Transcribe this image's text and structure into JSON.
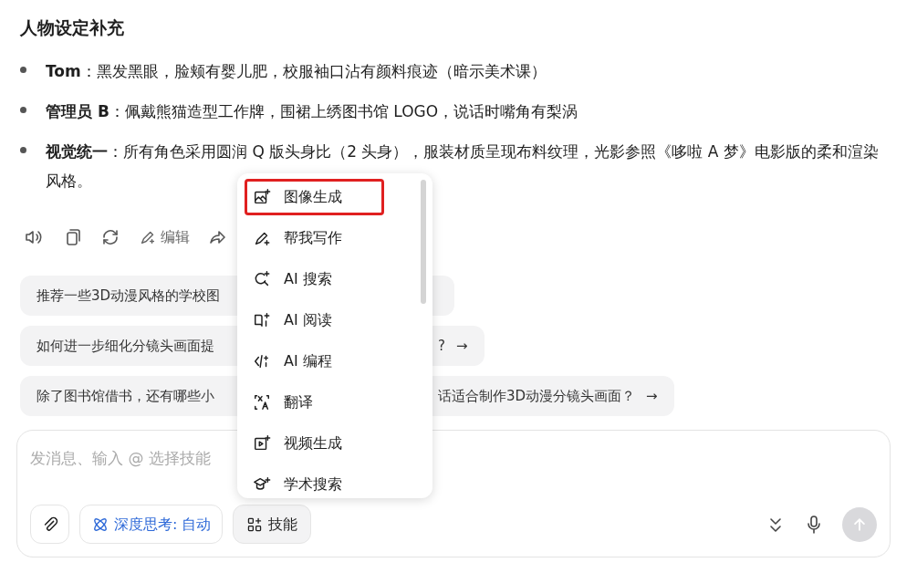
{
  "section_title": "人物设定补充",
  "bullets": [
    {
      "label": "Tom",
      "text": "：黑发黑眼，脸颊有婴儿肥，校服袖口沾有颜料痕迹（暗示美术课）"
    },
    {
      "label": "管理员 B",
      "text": "：佩戴熊猫造型工作牌，围裙上绣图书馆 LOGO，说话时嘴角有梨涡"
    },
    {
      "label": "视觉统一",
      "text": "：所有角色采用圆润 Q 版头身比（2 头身），服装材质呈现布料纹理，光影参照《哆啦 A 梦》电影版的柔和渲染风格。"
    }
  ],
  "actions": [
    {
      "kind": "speaker"
    },
    {
      "kind": "copy"
    },
    {
      "kind": "refresh"
    },
    {
      "kind": "edit",
      "label": "编辑"
    },
    {
      "kind": "share"
    }
  ],
  "suggestions": [
    {
      "text_before": "推荐一些3D动漫风格的学校图"
    },
    {
      "text_before": "如何进一步细化分镜头画面提",
      "text_after": "?",
      "arrow": "→"
    },
    {
      "text_before": "除了图书馆借书，还有哪些小",
      "text_after": "话适合制作3D动漫分镜头画面？",
      "arrow": "→"
    }
  ],
  "menu": {
    "items": [
      {
        "kind": "image",
        "label": "图像生成",
        "highlighted": true
      },
      {
        "kind": "write",
        "label": "帮我写作",
        "highlighted": false
      },
      {
        "kind": "search",
        "label": "AI 搜索",
        "highlighted": false
      },
      {
        "kind": "read",
        "label": "AI 阅读",
        "highlighted": false
      },
      {
        "kind": "code",
        "label": "AI 编程",
        "highlighted": false
      },
      {
        "kind": "translate",
        "label": "翻译",
        "highlighted": false
      },
      {
        "kind": "video",
        "label": "视频生成",
        "highlighted": false
      },
      {
        "kind": "academic",
        "label": "学术搜索",
        "highlighted": false
      }
    ]
  },
  "composer": {
    "placeholder": "发消息、输入 @ 选择技能",
    "deep_think": "深度思考: 自动",
    "skills": "技能"
  }
}
